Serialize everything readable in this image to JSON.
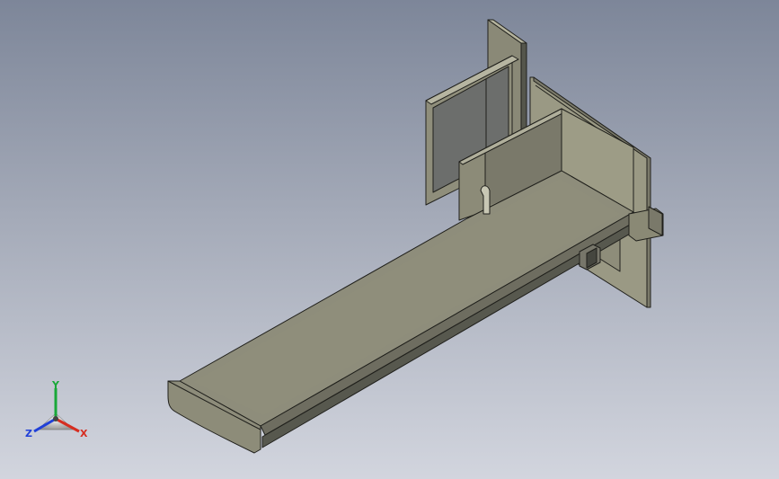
{
  "viewport": {
    "background_top": "#7d8699",
    "background_bottom": "#d2d5de",
    "model": {
      "body_color": "#8d8c79",
      "edge_color": "#20201c",
      "panel_color": "#6c6e6c"
    }
  },
  "triad": {
    "x_label": "X",
    "y_label": "Y",
    "z_label": "Z",
    "x_color": "#d62d20",
    "y_color": "#18a838",
    "z_color": "#2040d8"
  }
}
